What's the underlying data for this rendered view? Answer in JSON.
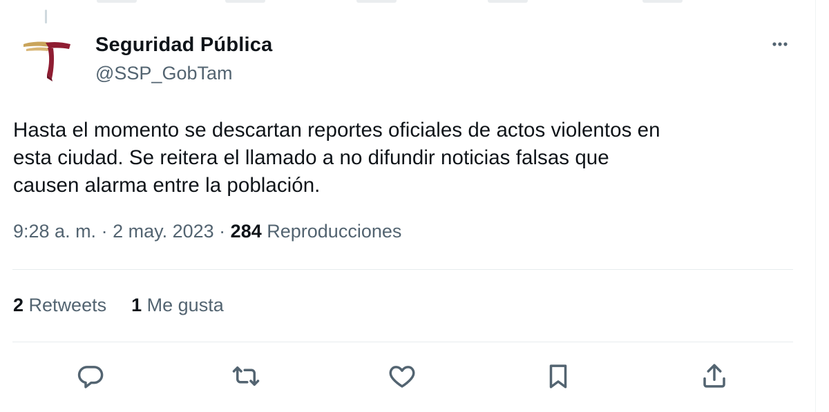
{
  "account": {
    "display_name": "Seguridad Pública",
    "handle": "@SSP_GobTam",
    "avatar_icon": "ssp-tamaulipas-logo",
    "logo_colors": [
      "#8f1d32",
      "#c9a45b"
    ]
  },
  "tweet": {
    "text": "Hasta el momento se descartan reportes oficiales de actos violentos en\nesta ciudad. Se reitera el llamado a no difundir noticias falsas que\ncausen alarma entre la población."
  },
  "meta": {
    "time": "9:28 a. m.",
    "separator": " · ",
    "date": "2 may. 2023",
    "views_count": "284",
    "views_label": "Reproducciones"
  },
  "stats": {
    "retweets_count": "2",
    "retweets_label": "Retweets",
    "likes_count": "1",
    "likes_label": "Me gusta"
  },
  "actions": [
    "reply-icon",
    "retweet-icon",
    "like-icon",
    "bookmark-icon",
    "share-icon"
  ],
  "colors": {
    "text_primary": "#0f1419",
    "text_secondary": "#536471",
    "divider": "#e7ecee",
    "brand_red": "#8f1d32",
    "brand_gold": "#c9a45b"
  }
}
